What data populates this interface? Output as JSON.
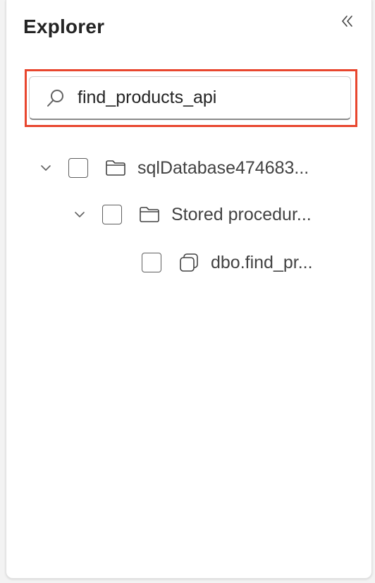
{
  "explorer": {
    "title": "Explorer",
    "collapse_icon": "double-chevron-left-icon"
  },
  "search": {
    "icon": "search-icon",
    "value": "find_products_api",
    "highlight_color": "#e8462e"
  },
  "tree": {
    "items": [
      {
        "label": "sqlDatabase474683...",
        "icon": "folder-icon",
        "expanded": true,
        "checked": false
      },
      {
        "label": "Stored procedur...",
        "icon": "folder-icon",
        "expanded": true,
        "checked": false
      },
      {
        "label": "dbo.find_pr...",
        "icon": "stored-procedure-icon",
        "checked": false
      }
    ]
  }
}
